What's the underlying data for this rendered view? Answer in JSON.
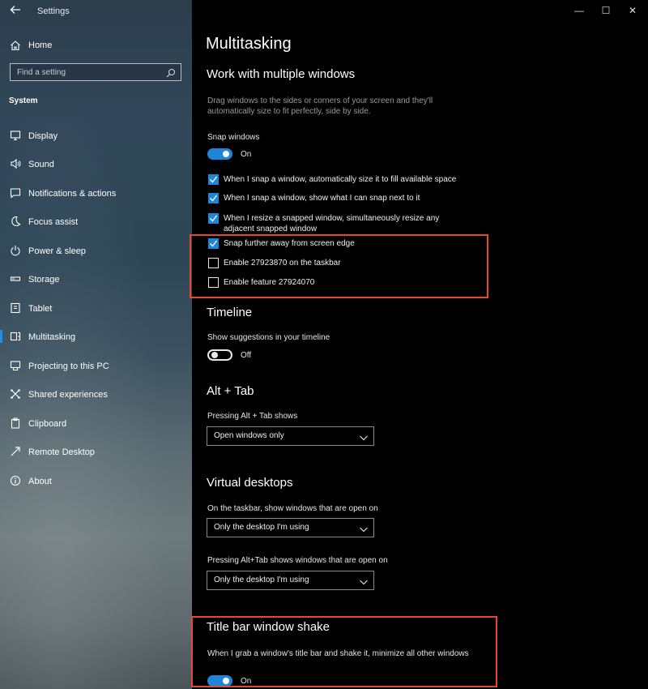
{
  "app": {
    "title": "Settings"
  },
  "window_controls": {
    "minimize": "—",
    "maximize": "☐",
    "close": "✕"
  },
  "sidebar": {
    "home": "Home",
    "search_placeholder": "Find a setting",
    "section": "System",
    "items": [
      {
        "label": "Display",
        "icon": "display-icon"
      },
      {
        "label": "Sound",
        "icon": "speaker-icon"
      },
      {
        "label": "Notifications & actions",
        "icon": "notification-icon"
      },
      {
        "label": "Focus assist",
        "icon": "moon-icon"
      },
      {
        "label": "Power & sleep",
        "icon": "power-icon"
      },
      {
        "label": "Storage",
        "icon": "storage-icon"
      },
      {
        "label": "Tablet",
        "icon": "tablet-icon"
      },
      {
        "label": "Multitasking",
        "icon": "multitasking-icon",
        "active": true
      },
      {
        "label": "Projecting to this PC",
        "icon": "projecting-icon"
      },
      {
        "label": "Shared experiences",
        "icon": "shared-experiences-icon"
      },
      {
        "label": "Clipboard",
        "icon": "clipboard-icon"
      },
      {
        "label": "Remote Desktop",
        "icon": "remote-desktop-icon"
      },
      {
        "label": "About",
        "icon": "info-icon"
      }
    ]
  },
  "main": {
    "title": "Multitasking",
    "windows": {
      "heading": "Work with multiple windows",
      "description": "Drag windows to the sides or corners of your screen and they'll automatically size to fit perfectly, side by side.",
      "snap_label": "Snap windows",
      "snap_state": "On",
      "options": [
        {
          "label": "When I snap a window, automatically size it to fill available space",
          "checked": true
        },
        {
          "label": "When I snap a window, show what I can snap next to it",
          "checked": true
        },
        {
          "label": "When I resize a snapped window, simultaneously resize any adjacent snapped window",
          "checked": true
        },
        {
          "label": "Snap further away from screen edge",
          "checked": true
        },
        {
          "label": "Enable 27923870 on the taskbar",
          "checked": false
        },
        {
          "label": "Enable feature 27924070",
          "checked": false
        }
      ]
    },
    "timeline": {
      "heading": "Timeline",
      "label": "Show suggestions in your timeline",
      "state": "Off"
    },
    "alttab": {
      "heading": "Alt + Tab",
      "label": "Pressing Alt + Tab shows",
      "value": "Open windows only"
    },
    "virtual_desktops": {
      "heading": "Virtual desktops",
      "taskbar_label": "On the taskbar, show windows that are open on",
      "taskbar_value": "Only the desktop I'm using",
      "alttab_label": "Pressing Alt+Tab shows windows that are open on",
      "alttab_value": "Only the desktop I'm using"
    },
    "shake": {
      "heading": "Title bar window shake",
      "description": "When I grab a window's title bar and shake it, minimize all other windows",
      "state": "On"
    }
  },
  "colors": {
    "accent": "#1e86d8",
    "highlight": "#e4492c",
    "background": "#000000"
  }
}
